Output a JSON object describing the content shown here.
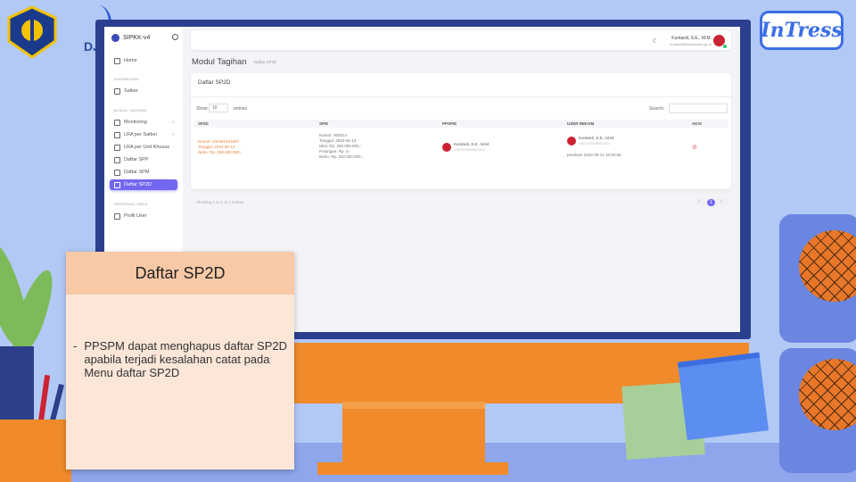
{
  "app": {
    "brand": "SIPKK-v4"
  },
  "sidebar": {
    "items": [
      {
        "label": "Home"
      },
      {
        "label": "Satker"
      },
      {
        "label": "Monitoring"
      },
      {
        "label": "LRA per Satker"
      },
      {
        "label": "LRA per Unit Khusus"
      },
      {
        "label": "Daftar SPP"
      },
      {
        "label": "Daftar SPM"
      },
      {
        "label": "Daftar SP2D"
      },
      {
        "label": "Profil User"
      }
    ],
    "headers": [
      "DASHBOARD",
      "MODUL TAGIHAN",
      "PERSONAL AREA"
    ]
  },
  "topbar": {
    "user_name": "Kuntardi, S.E., M.M.",
    "user_email": "kuntardi@kemenkeu.go.id"
  },
  "page": {
    "title": "Modul Tagihan",
    "breadcrumb": "Daftar SP2D"
  },
  "card": {
    "title": "Daftar SP2D",
    "show_label": "Show",
    "show_value": "10",
    "entries_label": "entries",
    "search_label": "Search:",
    "columns": [
      "SP2D",
      "SPM",
      "PPSPM",
      "USER REKAM",
      "AKSI"
    ],
    "row": {
      "sp2d": [
        "Nomor: 230491401007",
        "Tanggal: 2024-05-14",
        "Netto: Rp. 250.000.000,-"
      ],
      "spm": [
        "Nomor: 00001A",
        "Tanggal: 2024-05-13",
        "Nilai: Rp. 250.000.000,-",
        "Potongan: Rp. 0,-",
        "Netto: Rp. 250.000.000,-"
      ],
      "ppspm_name": "Kuntardi, S.E., M.M.",
      "ppspm_nip": "198702262006021002",
      "user_name": "Kuntardi, S.E., M.M.",
      "user_nip": "198702262006021002",
      "user_time": "perekam 2024-05-14 10:20:55"
    },
    "showing": "Showing 1 to 1 of 1 entries",
    "page_current": "1"
  },
  "callout": {
    "title": "Daftar SP2D",
    "bullet": "-",
    "text": "PPSPM dapat menghapus daftar SP2D apabila terjadi kesalahan catat pada Menu daftar SP2D"
  },
  "logos": {
    "djpb": "DJPb",
    "intress": "InTress"
  },
  "colors": {
    "accent": "#7367f0",
    "background": "#b3c9f5",
    "monitor": "#2b3f8f",
    "orange": "#f08a2a"
  }
}
